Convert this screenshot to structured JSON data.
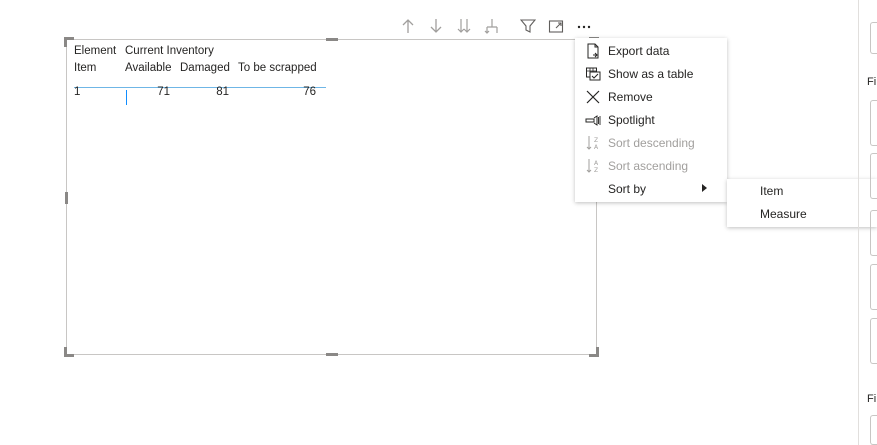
{
  "toolbar": {
    "icons": [
      "arrow-up-icon",
      "arrow-down-icon",
      "double-arrow-down-icon",
      "expand-hierarchy-icon",
      "filter-icon",
      "focus-mode-icon",
      "more-options-icon"
    ]
  },
  "matrix": {
    "row_header_top": "Element",
    "row_header": "Item",
    "column_group": "Current Inventory",
    "columns": [
      "Available",
      "Damaged",
      "To be scrapped"
    ],
    "rows": [
      {
        "item": "1",
        "values": [
          "71",
          "81",
          "76"
        ]
      }
    ]
  },
  "context_menu": {
    "items": [
      {
        "label": "Export data",
        "icon": "export-icon",
        "disabled": false
      },
      {
        "label": "Show as a table",
        "icon": "table-icon",
        "disabled": false
      },
      {
        "label": "Remove",
        "icon": "close-icon",
        "disabled": false
      },
      {
        "label": "Spotlight",
        "icon": "spotlight-icon",
        "disabled": false
      },
      {
        "label": "Sort descending",
        "icon": "sort-descending-icon",
        "disabled": true
      },
      {
        "label": "Sort ascending",
        "icon": "sort-ascending-icon",
        "disabled": true
      },
      {
        "label": "Sort by",
        "icon": "",
        "disabled": false,
        "has_submenu": true
      }
    ],
    "sort_by_submenu": [
      "Item",
      "Measure"
    ]
  },
  "right_pane": {
    "labels": [
      "Fi",
      "Fi"
    ]
  },
  "colors": {
    "accent": "#118dff",
    "header_line": "#6fb6e6",
    "disabled_text": "#a19f9d"
  }
}
